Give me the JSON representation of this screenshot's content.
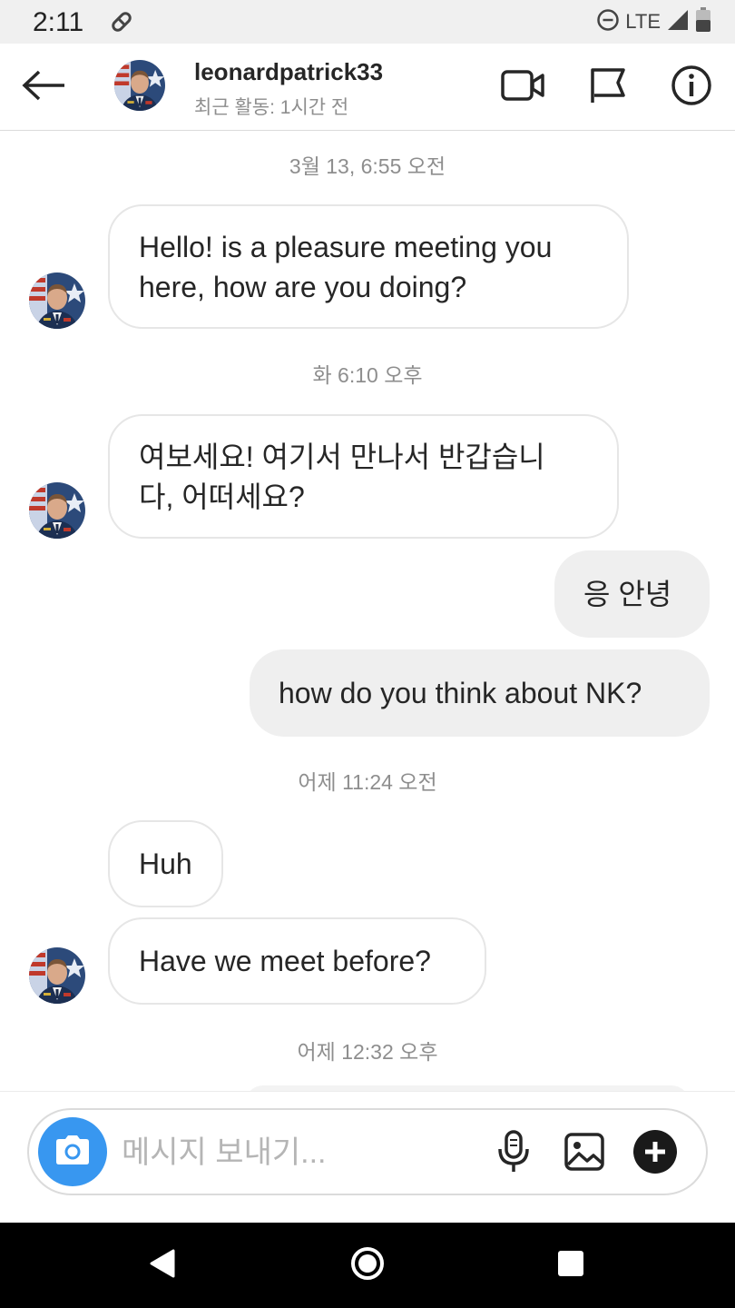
{
  "status_bar": {
    "time": "2:11",
    "network": "LTE"
  },
  "header": {
    "username": "leonardpatrick33",
    "activity": "최근 활동: 1시간 전"
  },
  "thread": {
    "timestamps": [
      "3월 13, 6:55 오전",
      "화 6:10 오후",
      "어제 11:24 오전",
      "어제 12:32 오후"
    ],
    "messages": [
      {
        "sender": "them",
        "lines": [
          "Hello! is a pleasure meeting you",
          "here, how are you doing?"
        ]
      },
      {
        "sender": "them",
        "lines": [
          "여보세요! 여기서 만나서 반갑습니",
          "다, 어떠세요?"
        ]
      },
      {
        "sender": "me",
        "text": "응 안녕"
      },
      {
        "sender": "me",
        "text": "how do you think about NK?"
      },
      {
        "sender": "them",
        "text": "Huh"
      },
      {
        "sender": "them",
        "text": "Have we meet before?"
      }
    ]
  },
  "composer": {
    "placeholder": "메시지 보내기..."
  },
  "colors": {
    "accent": "#3897f0",
    "outgoing_bubble": "#efefef",
    "incoming_border": "#e6e6e6",
    "muted_text": "#8e8e8e"
  },
  "icons": {
    "back": "arrow-left-icon",
    "video": "video-camera-icon",
    "flag": "flag-icon",
    "info": "info-icon",
    "camera": "camera-icon",
    "mic": "microphone-icon",
    "gallery": "image-icon",
    "plus": "plus-circle-icon"
  }
}
